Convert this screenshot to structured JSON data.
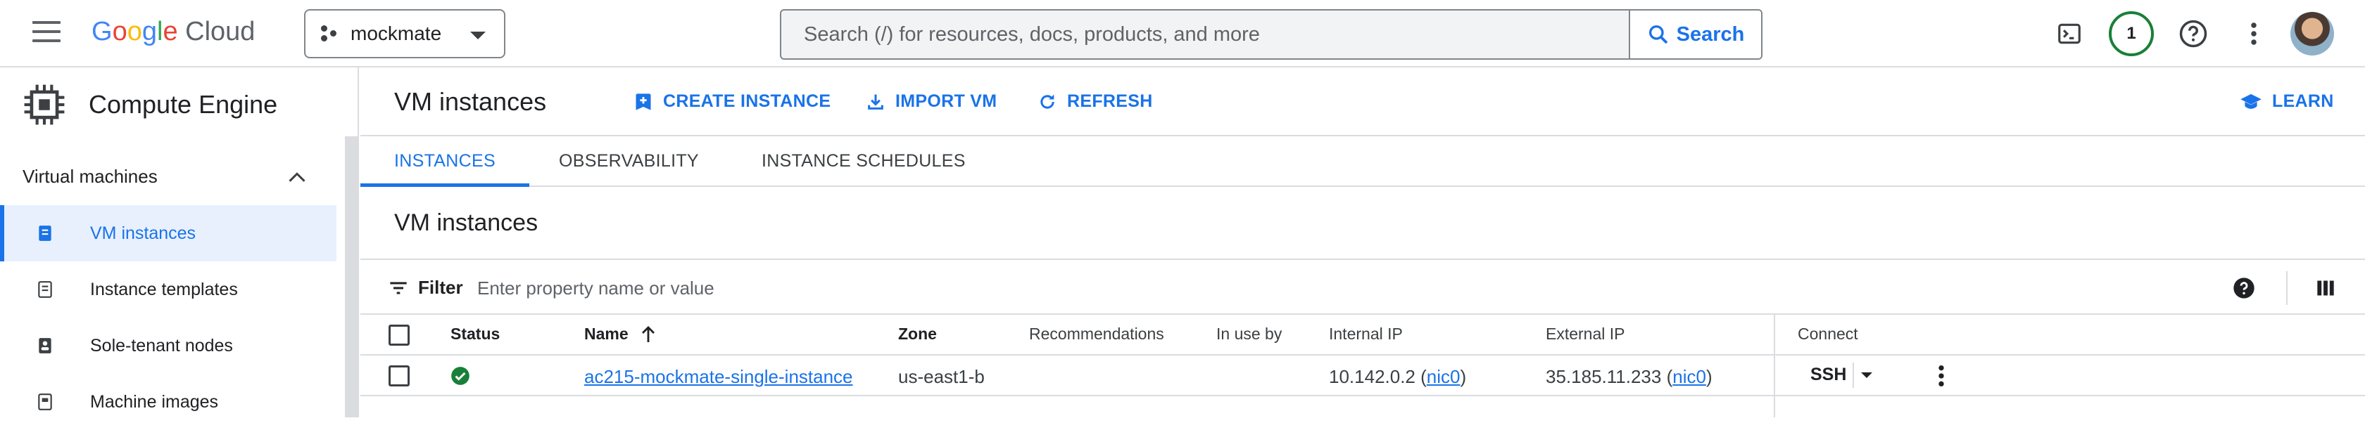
{
  "header": {
    "logo_google": "Google",
    "logo_cloud": "Cloud",
    "project": "mockmate",
    "search_placeholder": "Search (/) for resources, docs, products, and more",
    "search_button": "Search",
    "notification_count": "1"
  },
  "sidebar": {
    "product": "Compute Engine",
    "group": "Virtual machines",
    "items": [
      {
        "label": "VM instances",
        "icon": "vm-icon"
      },
      {
        "label": "Instance templates",
        "icon": "template-icon"
      },
      {
        "label": "Sole-tenant nodes",
        "icon": "node-icon"
      },
      {
        "label": "Machine images",
        "icon": "image-icon"
      }
    ]
  },
  "toolbar": {
    "title": "VM instances",
    "create": "CREATE INSTANCE",
    "import": "IMPORT VM",
    "refresh": "REFRESH",
    "learn": "LEARN"
  },
  "tabs": [
    "INSTANCES",
    "OBSERVABILITY",
    "INSTANCE SCHEDULES"
  ],
  "section_title": "VM instances",
  "filter": {
    "label": "Filter",
    "placeholder": "Enter property name or value"
  },
  "table": {
    "columns": [
      "Status",
      "Name",
      "Zone",
      "Recommendations",
      "In use by",
      "Internal IP",
      "External IP",
      "Connect"
    ],
    "rows": [
      {
        "status": "running",
        "name": "ac215-mockmate-single-instance",
        "zone": "us-east1-b",
        "recommendations": "",
        "in_use_by": "",
        "internal_ip": "10.142.0.2",
        "internal_nic": "nic0",
        "external_ip": "35.185.11.233",
        "external_nic": "nic0",
        "connect": "SSH"
      }
    ]
  },
  "colors": {
    "accent": "#1a73e8",
    "status_ok": "#188038",
    "active_bg": "#e8f0fe"
  }
}
